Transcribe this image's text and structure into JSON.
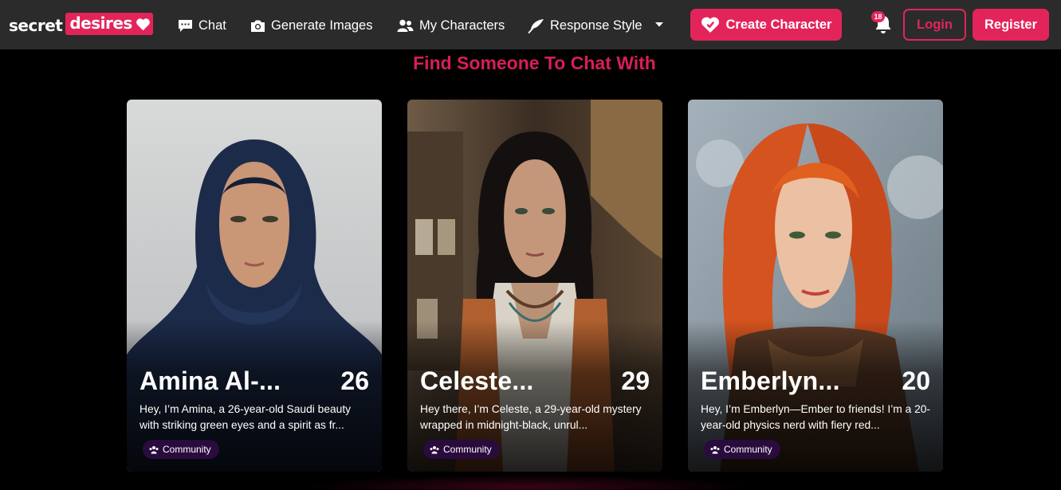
{
  "header": {
    "logo": {
      "word1": "secret",
      "word2": "desires"
    },
    "nav": {
      "chat": "Chat",
      "generate_images": "Generate Images",
      "my_characters": "My Characters",
      "response_style": "Response Style"
    },
    "create_character": "Create Character",
    "notifications_badge": "18",
    "login": "Login",
    "register": "Register"
  },
  "main": {
    "title": "Find Someone To Chat With",
    "cards": [
      {
        "name": "Amina Al-...",
        "age": "26",
        "description": "Hey, I’m Amina, a 26-year-old Saudi beauty with striking green eyes and a spirit as fr...",
        "tag": "Community"
      },
      {
        "name": "Celeste...",
        "age": "29",
        "description": "Hey there, I’m Celeste, a 29-year-old mystery wrapped in midnight-black, unrul...",
        "tag": "Community"
      },
      {
        "name": "Emberlyn...",
        "age": "20",
        "description": "Hey, I’m Emberlyn—Ember to friends! I’m a 20-year-old physics nerd with fiery red...",
        "tag": "Community"
      }
    ]
  },
  "colors": {
    "accent": "#e3245a",
    "header_bg": "#2b2b2b",
    "title": "#d81e56",
    "tag_bg": "#2a0b3d"
  }
}
